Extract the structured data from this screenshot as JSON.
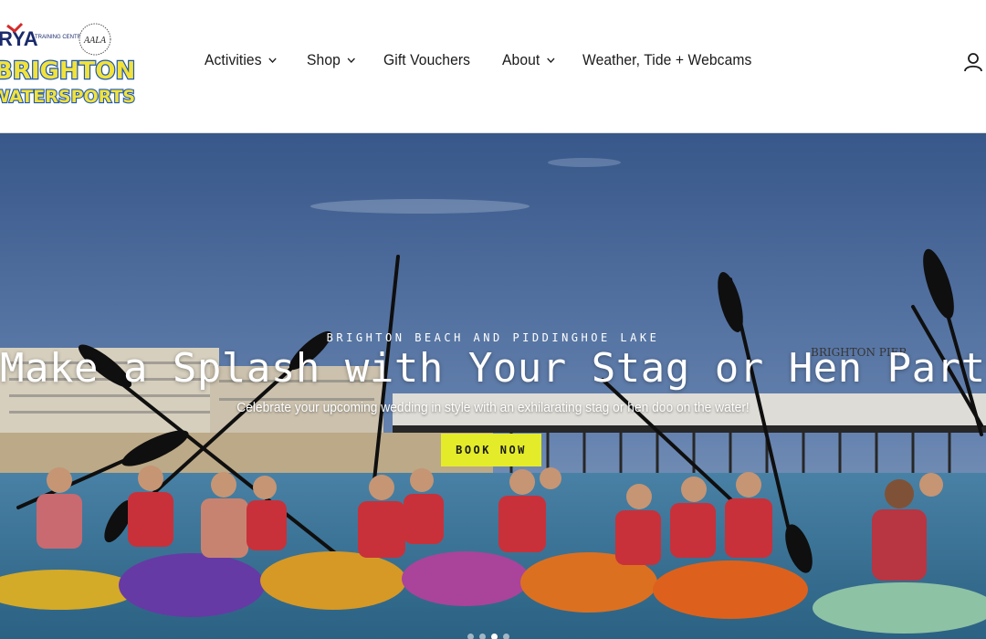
{
  "logo": {
    "rya_text": "RYA",
    "rya_sub": "TRAINING CENTRE",
    "aala_text": "AALA",
    "brand_line1": "BRIGHTON",
    "brand_line2": "WATERSPORTS"
  },
  "nav": {
    "items": [
      {
        "label": "Activities",
        "has_dropdown": true
      },
      {
        "label": "Shop",
        "has_dropdown": true
      },
      {
        "label": "Gift Vouchers",
        "has_dropdown": false
      },
      {
        "label": "About",
        "has_dropdown": true
      },
      {
        "label": "Weather, Tide + Webcams",
        "has_dropdown": false
      }
    ],
    "account_icon": "user-icon"
  },
  "hero": {
    "eyebrow": "BRIGHTON BEACH AND PIDDINGHOE LAKE",
    "headline": "Make a Splash with Your Stag or Hen Party!",
    "subheading": "Celebrate your upcoming wedding in style with an exhilarating stag or hen doo on the water!",
    "cta_label": "BOOK NOW",
    "pier_sign": "BRIGHTON PIER",
    "slides_total": 4,
    "active_slide": 3
  },
  "colors": {
    "cta": "#e4ec2a",
    "header_bg": "#ffffff",
    "sky": "#4a6fa5",
    "sea": "#3f7fa8"
  }
}
